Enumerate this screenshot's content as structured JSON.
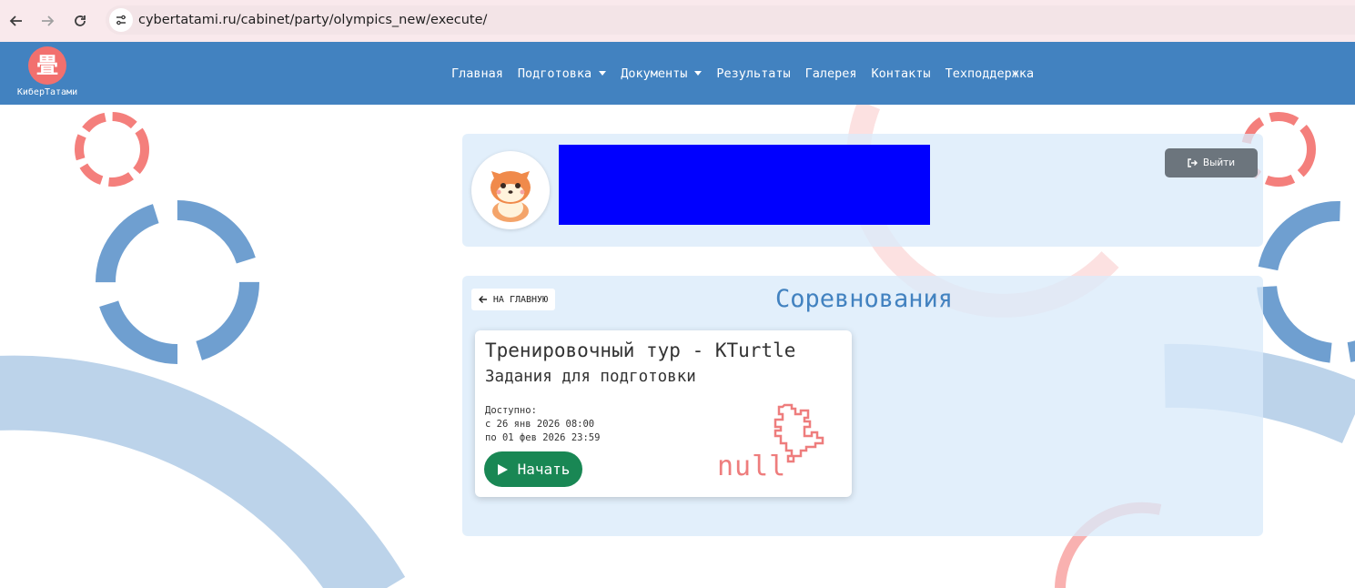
{
  "browser": {
    "url": "cybertatami.ru/cabinet/party/olympics_new/execute/"
  },
  "site": {
    "logo_text": "КиберТатами",
    "logo_glyph": "畳",
    "nav": [
      {
        "label": "Главная",
        "dropdown": false
      },
      {
        "label": "Подготовка",
        "dropdown": true
      },
      {
        "label": "Документы",
        "dropdown": true
      },
      {
        "label": "Результаты",
        "dropdown": false
      },
      {
        "label": "Галерея",
        "dropdown": false
      },
      {
        "label": "Контакты",
        "dropdown": false
      },
      {
        "label": "Техподдержка",
        "dropdown": false
      }
    ]
  },
  "profile": {
    "logout_label": "Выйти"
  },
  "competitions": {
    "back_label": "НА ГЛАВНУЮ",
    "title": "Соревнования",
    "card": {
      "title": "Тренировочный тур - KTurtle",
      "subtitle": "Задания для подготовки",
      "available_label": "Доступно:",
      "from": "с 26 янв 2026 08:00",
      "to": "по 01 фев 2026 23:59",
      "start_label": "Начать",
      "image_text": "null"
    }
  },
  "colors": {
    "navbar": "#4282c0",
    "accent_red": "#f2706e",
    "start_green": "#198754",
    "logout_gray": "#6c757d",
    "title_blue": "#4282c0"
  }
}
